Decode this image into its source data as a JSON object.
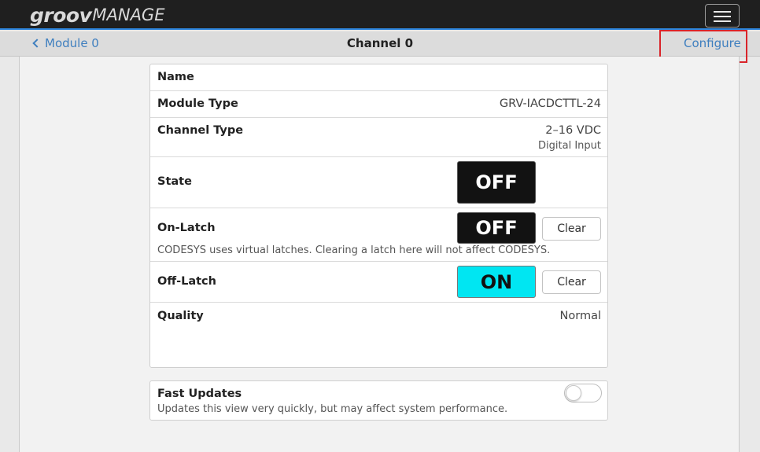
{
  "header": {
    "logo_part1": "groov",
    "logo_part2": "MANAGE",
    "menu_icon": "hamburger-menu-icon"
  },
  "nav": {
    "back_label": "Module 0",
    "back_icon": "chevron-left-icon",
    "title": "Channel 0",
    "configure_label": "Configure"
  },
  "channel": {
    "name_label": "Name",
    "name_value": "",
    "module_type_label": "Module Type",
    "module_type_value": "GRV-IACDCTTL-24",
    "channel_type_label": "Channel Type",
    "channel_type_value": "2–16 VDC",
    "channel_type_sub": "Digital Input",
    "state_label": "State",
    "state_value": "OFF",
    "on_latch_label": "On-Latch",
    "on_latch_value": "OFF",
    "on_latch_clear": "Clear",
    "latch_note": "CODESYS uses virtual latches. Clearing a latch here will not affect CODESYS.",
    "off_latch_label": "Off-Latch",
    "off_latch_value": "ON",
    "off_latch_clear": "Clear",
    "quality_label": "Quality",
    "quality_value": "Normal"
  },
  "fast_updates": {
    "label": "Fast Updates",
    "description": "Updates this view very quickly, but may affect system performance.",
    "enabled": false
  },
  "colors": {
    "topbar": "#1f1f1f",
    "accent_link": "#3f7fbf",
    "on_badge": "#00e6f2",
    "off_badge": "#121212",
    "highlight_box": "#d9242a"
  }
}
